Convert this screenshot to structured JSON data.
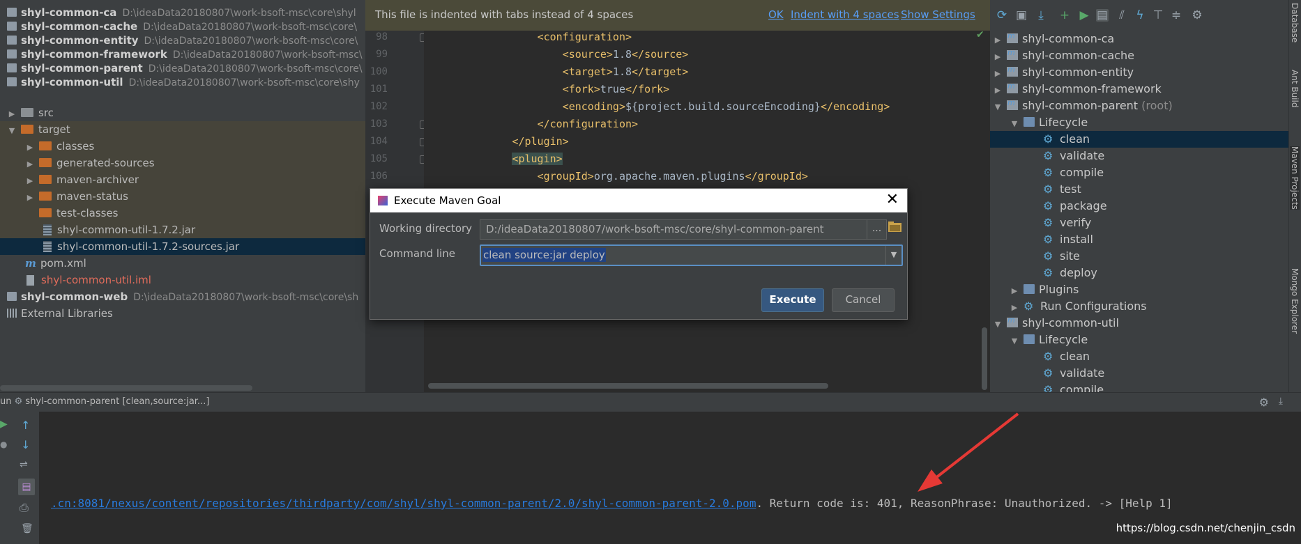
{
  "project_tree": {
    "items": [
      {
        "name": "shyl-common-ca",
        "path": "D:\\ideaData20180807\\work-bsoft-msc\\core\\shyl"
      },
      {
        "name": "shyl-common-cache",
        "path": "D:\\ideaData20180807\\work-bsoft-msc\\core\\"
      },
      {
        "name": "shyl-common-entity",
        "path": "D:\\ideaData20180807\\work-bsoft-msc\\core\\"
      },
      {
        "name": "shyl-common-framework",
        "path": "D:\\ideaData20180807\\work-bsoft-msc\\"
      },
      {
        "name": "shyl-common-parent",
        "path": "D:\\ideaData20180807\\work-bsoft-msc\\core\\"
      },
      {
        "name": "shyl-common-util",
        "path": "D:\\ideaData20180807\\work-bsoft-msc\\core\\shy"
      }
    ],
    "src": "src",
    "target": "target",
    "target_children": [
      "classes",
      "generated-sources",
      "maven-archiver",
      "maven-status",
      "test-classes"
    ],
    "jar1": "shyl-common-util-1.7.2.jar",
    "jar2": "shyl-common-util-1.7.2-sources.jar",
    "pom": "pom.xml",
    "iml": "shyl-common-util.iml",
    "web": {
      "name": "shyl-common-web",
      "path": "D:\\ideaData20180807\\work-bsoft-msc\\core\\sh"
    },
    "external": "External Libraries",
    "colors": {
      "selected": "#0d293e",
      "iml_text": "#e06c5b"
    }
  },
  "notification": {
    "message": "This file is indented with tabs instead of 4 spaces",
    "ok": "OK",
    "indent": "Indent with 4 spaces",
    "settings": "Show Settings"
  },
  "editor": {
    "line_numbers": [
      "98",
      "99",
      "100",
      "101",
      "102",
      "103",
      "104",
      "105",
      "106"
    ],
    "lines": [
      {
        "indent": "                  ",
        "open": "<configuration>",
        "text": "",
        "close": ""
      },
      {
        "indent": "                      ",
        "open": "<source>",
        "text": "1.8",
        "close": "</source>"
      },
      {
        "indent": "                      ",
        "open": "<target>",
        "text": "1.8",
        "close": "</target>"
      },
      {
        "indent": "                      ",
        "open": "<fork>",
        "text": "true",
        "close": "</fork>"
      },
      {
        "indent": "                      ",
        "open": "<encoding>",
        "text": "${project.build.sourceEncoding}",
        "close": "</encoding>"
      },
      {
        "indent": "                  ",
        "open": "</configuration>",
        "text": "",
        "close": ""
      },
      {
        "indent": "              ",
        "open": "</plugin>",
        "text": "",
        "close": ""
      },
      {
        "indent": "              ",
        "open": "<plugin>",
        "text": "",
        "close": ""
      },
      {
        "indent": "                  ",
        "open": "<groupId>",
        "text": "org.apache.maven.plugins",
        "close": "</groupId>"
      }
    ]
  },
  "maven_panel": {
    "modules_top": [
      "shyl-common-ca",
      "shyl-common-cache",
      "shyl-common-entity",
      "shyl-common-framework"
    ],
    "parent": "shyl-common-parent",
    "parent_suffix": "(root)",
    "lifecycle": "Lifecycle",
    "goals": [
      "clean",
      "validate",
      "compile",
      "test",
      "package",
      "verify",
      "install",
      "site",
      "deploy"
    ],
    "plugins": "Plugins",
    "run_configs": "Run Configurations",
    "util": "shyl-common-util",
    "util_lifecycle": "Lifecycle",
    "util_goals": [
      "clean",
      "validate",
      "compile"
    ]
  },
  "side_tabs": [
    "Database",
    "Ant Build",
    "Maven Projects",
    "Mongo Explorer"
  ],
  "run_panel": {
    "title": "un",
    "config": "shyl-common-parent [clean,source:jar...]",
    "console_link": ".cn:8081/nexus/content/repositories/thirdparty/com/shyl/shyl-common-parent/2.0/shyl-common-parent-2.0.pom",
    "console_rest": ". Return code is: 401, ReasonPhrase: Unauthorized. -> [Help 1]"
  },
  "watermark": "https://blog.csdn.net/chenjin_csdn",
  "dialog": {
    "title": "Execute Maven Goal",
    "working_dir_label": "Working directory",
    "working_dir_value": "D:/ideaData20180807/work-bsoft-msc/core/shyl-common-parent",
    "browse": "...",
    "command_label": "Command line",
    "command_value": "clean source:jar deploy",
    "execute": "Execute",
    "cancel": "Cancel",
    "colors": {
      "accent": "#365880",
      "focus": "#5a8fc4"
    }
  },
  "icons": [
    "refresh-icon",
    "add-maven-project-icon",
    "download-icon",
    "plus-icon",
    "run-icon",
    "toggle-offline-icon",
    "skip-tests-icon",
    "lifecycle-icon",
    "show-dependencies-icon",
    "collapse-all-icon",
    "settings-icon"
  ]
}
